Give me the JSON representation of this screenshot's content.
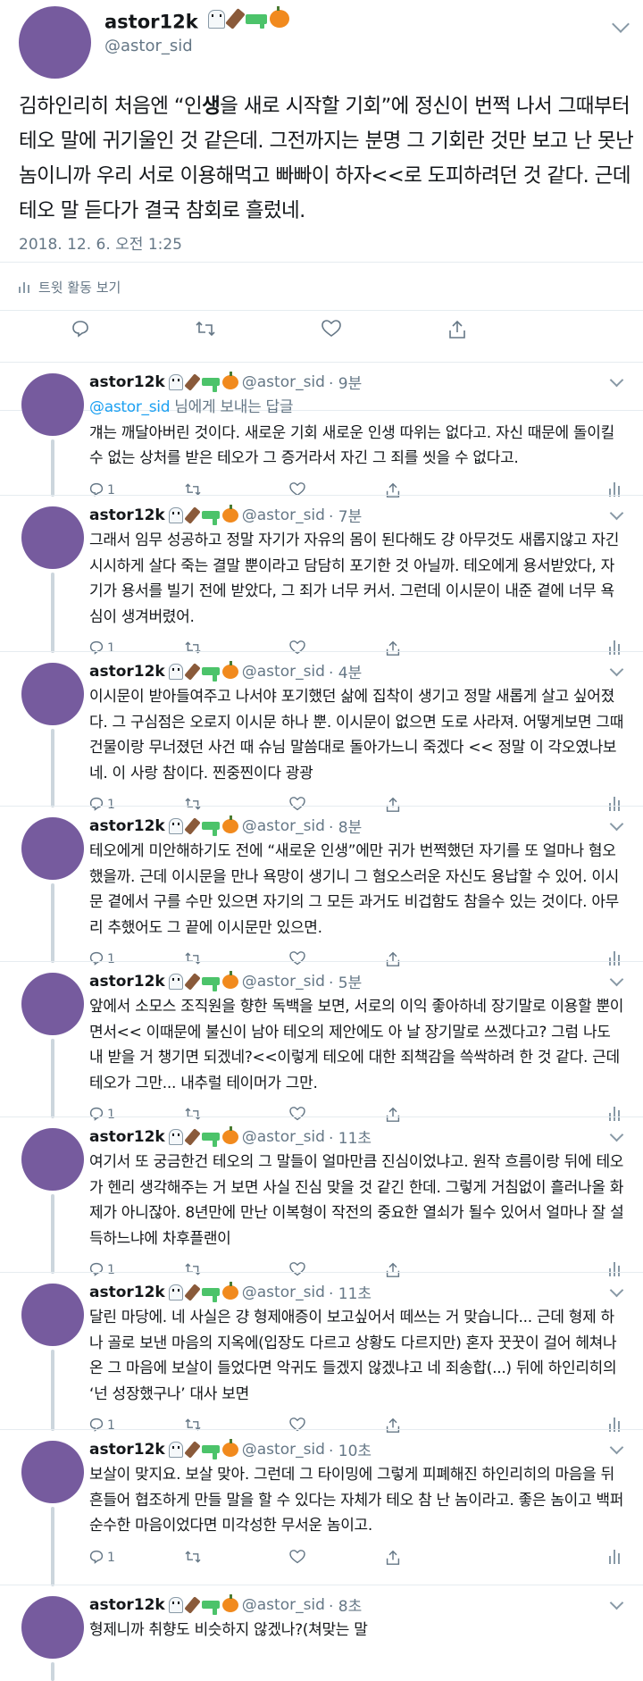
{
  "main_tweet": {
    "display_name": "astor12k",
    "handle": "@astor_sid",
    "text_before": "김하인리히 처음엔 “인",
    "text_bold": "생",
    "text_after": "을 새로 시작할 기회”에 정신이 번쩍 나서 그때부터 테오 말에 귀기울인 것 같은데. 그전까지는 분명 그 기회란 것만 보고 난 못난 놈이니까 우리 서로 이용해먹고 빠빠이 하자<<로 도피하려던 것 같다. 근데 테오 말 듣다가 결국 참회로 흘렀네.",
    "timestamp": "2018. 12. 6. 오전 1:25",
    "activity_label": "트윗 활동 보기"
  },
  "replies": [
    {
      "name": "astor12k",
      "handle": "@astor_sid",
      "time": "· 9분",
      "reply_to_handle": "@astor_sid",
      "reply_to_rest": " 님에게 보내는 답글",
      "text": "걔는 깨달아버린 것이다. 새로운 기회 새로운 인생 따위는 없다고. 자신 때문에 돌이킬 수 없는 상처를 받은 테오가 그 증거라서 자긴 그 죄를 씻을 수 없다고.",
      "count": "1"
    },
    {
      "name": "astor12k",
      "handle": "@astor_sid",
      "time": "· 7분",
      "text": "그래서 임무 성공하고 정말 자기가 자유의 몸이 된다해도 걍 아무것도 새롭지않고 자긴 시시하게 살다 죽는 결말 뿐이라고 담담히 포기한 것 아닐까. 테오에게 용서받았다, 자기가 용서를 빌기 전에 받았다, 그 죄가 너무 커서. 그런데 이시문이 내준 곁에 너무 욕심이 생겨버렸어.",
      "count": "1"
    },
    {
      "name": "astor12k",
      "handle": "@astor_sid",
      "time": "· 4분",
      "text": "이시문이 받아들여주고 나서야 포기했던 삶에 집착이 생기고 정말 새롭게 살고 싶어졌다. 그 구심점은 오로지 이시문 하나 뿐. 이시문이 없으면 도로 사라져. 어떻게보면 그때 건물이랑 무너졌던 사건 때 슈님 말씀대로 돌아가느니 죽겠다 << 정말 이 각오였나보네. 이 사랑 참이다. 찐중찐이다 광광",
      "count": "1"
    },
    {
      "name": "astor12k",
      "handle": "@astor_sid",
      "time": "· 8분",
      "text": "테오에게 미안해하기도 전에 “새로운 인생”에만 귀가 번쩍했던 자기를 또 얼마나 혐오했을까. 근데 이시문을 만나 욕망이 생기니 그 혐오스러운 자신도 용납할 수 있어. 이시문 곁에서 구를 수만 있으면 자기의 그 모든 과거도 비겁함도 참을수 있는 것이다. 아무리 추했어도 그 끝에 이시문만 있으면.",
      "count": "1"
    },
    {
      "name": "astor12k",
      "handle": "@astor_sid",
      "time": "· 5분",
      "text": "앞에서 소모스 조직원을 향한 독백을 보면, 서로의 이익 좋아하네 장기말로 이용할 뿐이면서<< 이때문에 불신이 남아 테오의 제안에도 아 날 장기말로 쓰겠다고? 그럼 나도 내 받을 거 챙기면 되겠네?<<이렇게 테오에 대한 죄책감을 쓱싹하려 한 것 같다. 근데 테오가 그만... 내추럴 테이머가 그만.",
      "count": "1"
    },
    {
      "name": "astor12k",
      "handle": "@astor_sid",
      "time": "· 11초",
      "text": "여기서 또 궁금한건 테오의 그 말들이 얼마만큼 진심이었냐고. 원작 흐름이랑 뒤에 테오가 헨리 생각해주는 거 보면 사실 진심 맞을 것 같긴 한데. 그렇게 거침없이 흘러나올 화제가 아니잖아. 8년만에 만난 이복형이 작전의 중요한 열쇠가 될수 있어서 얼마나 잘 설득하느냐에 차후플랜이",
      "count": "1"
    },
    {
      "name": "astor12k",
      "handle": "@astor_sid",
      "time": "· 11초",
      "text": "달린 마당에. 네 사실은 걍 형제애증이 보고싶어서 떼쓰는 거 맞습니다... 근데 형제 하나 골로 보낸 마음의 지옥에(입장도 다르고 상황도 다르지만) 혼자 꿋꿋이 걸어 헤쳐나온 그 마음에 보살이 들었다면 악귀도 들겠지 않겠냐고 네 죄송합(...) 뒤에 하인리히의 ‘넌 성장했구나’ 대사 보면",
      "count": "1"
    },
    {
      "name": "astor12k",
      "handle": "@astor_sid",
      "time": "· 10초",
      "text": "보살이 맞지요. 보살 맞아. 그런데 그 타이밍에 그렇게 피폐해진 하인리히의 마음을 뒤흔들어 협조하게 만들 말을 할 수 있다는 자체가 테오 참 난 놈이라고. 좋은 놈이고 백퍼 순수한 마음이었다면 미각성한 무서운 놈이고.",
      "count": "1"
    },
    {
      "name": "astor12k",
      "handle": "@astor_sid",
      "time": "· 8초",
      "text": "형제니까 취향도 비슷하지 않겠나?(쳐맞는 말",
      "count": ""
    }
  ],
  "icons": [
    "ghost-emoji",
    "coffin-emoji",
    "water-pistol-emoji",
    "pumpkin-emoji",
    "reply-icon",
    "retweet-icon",
    "like-icon",
    "share-icon",
    "analytics-icon",
    "chevron-down-icon"
  ],
  "colors": {
    "avatar": "#765b9e",
    "link": "#1da1f2",
    "muted": "#657786",
    "icon": "#8899a6",
    "border": "#e6ecf0"
  }
}
